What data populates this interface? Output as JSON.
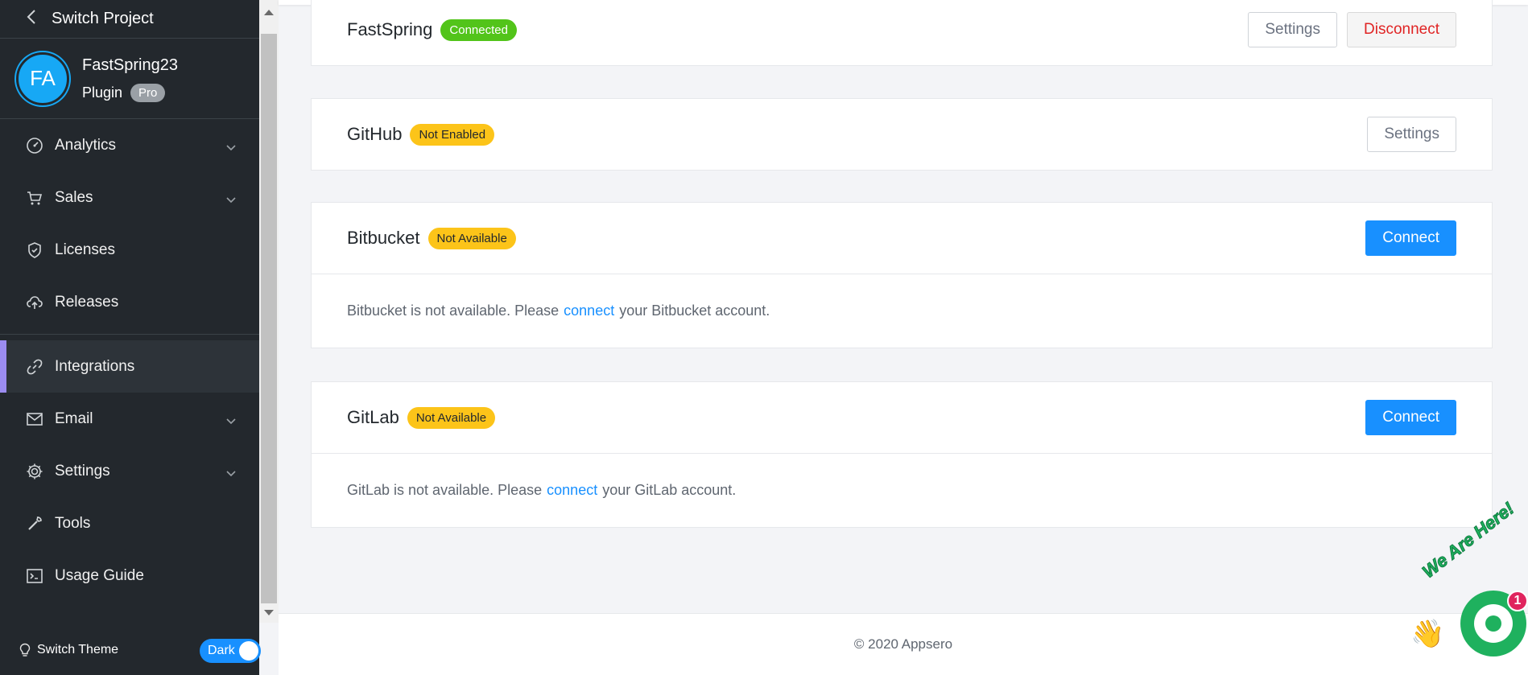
{
  "sidebar": {
    "back_label": "Switch Project",
    "project": {
      "initials": "FA",
      "name": "FastSpring23",
      "type": "Plugin",
      "tier": "Pro"
    },
    "items": [
      {
        "label": "Analytics",
        "icon": "dashboard-icon",
        "expandable": true
      },
      {
        "label": "Sales",
        "icon": "cart-icon",
        "expandable": true
      },
      {
        "label": "Licenses",
        "icon": "shield-icon",
        "expandable": false
      },
      {
        "label": "Releases",
        "icon": "cloud-upload-icon",
        "expandable": false
      },
      {
        "label": "Integrations",
        "icon": "link-icon",
        "expandable": false,
        "active": true
      },
      {
        "label": "Email",
        "icon": "mail-icon",
        "expandable": true
      },
      {
        "label": "Settings",
        "icon": "gear-icon",
        "expandable": true
      },
      {
        "label": "Tools",
        "icon": "wrench-icon",
        "expandable": false
      },
      {
        "label": "Usage Guide",
        "icon": "terminal-icon",
        "expandable": false
      }
    ],
    "theme": {
      "label": "Switch Theme",
      "toggle_label": "Dark"
    }
  },
  "integrations": [
    {
      "title": "FastSpring",
      "status": "Connected",
      "status_color": "#52c41a",
      "actions": [
        "Settings",
        "Disconnect"
      ]
    },
    {
      "title": "GitHub",
      "status": "Not Enabled",
      "status_color": "#fcc419",
      "actions": [
        "Settings"
      ]
    },
    {
      "title": "Bitbucket",
      "status": "Not Available",
      "status_color": "#fcc419",
      "actions": [
        "Connect"
      ],
      "message_before": "Bitbucket is not available. Please",
      "message_link": "connect",
      "message_after": "your Bitbucket account."
    },
    {
      "title": "GitLab",
      "status": "Not Available",
      "status_color": "#fcc419",
      "actions": [
        "Connect"
      ],
      "message_before": "GitLab is not available. Please",
      "message_link": "connect",
      "message_after": "your GitLab account."
    }
  ],
  "footer": {
    "copyright": "© 2020 Appsero"
  },
  "chat": {
    "tagline": "We Are Here!",
    "unread": "1"
  },
  "colors": {
    "accent": "#1890ff",
    "sidebar_bg": "#23282d",
    "active_marker": "#9b8cf0",
    "chat": "#1fb15e"
  }
}
